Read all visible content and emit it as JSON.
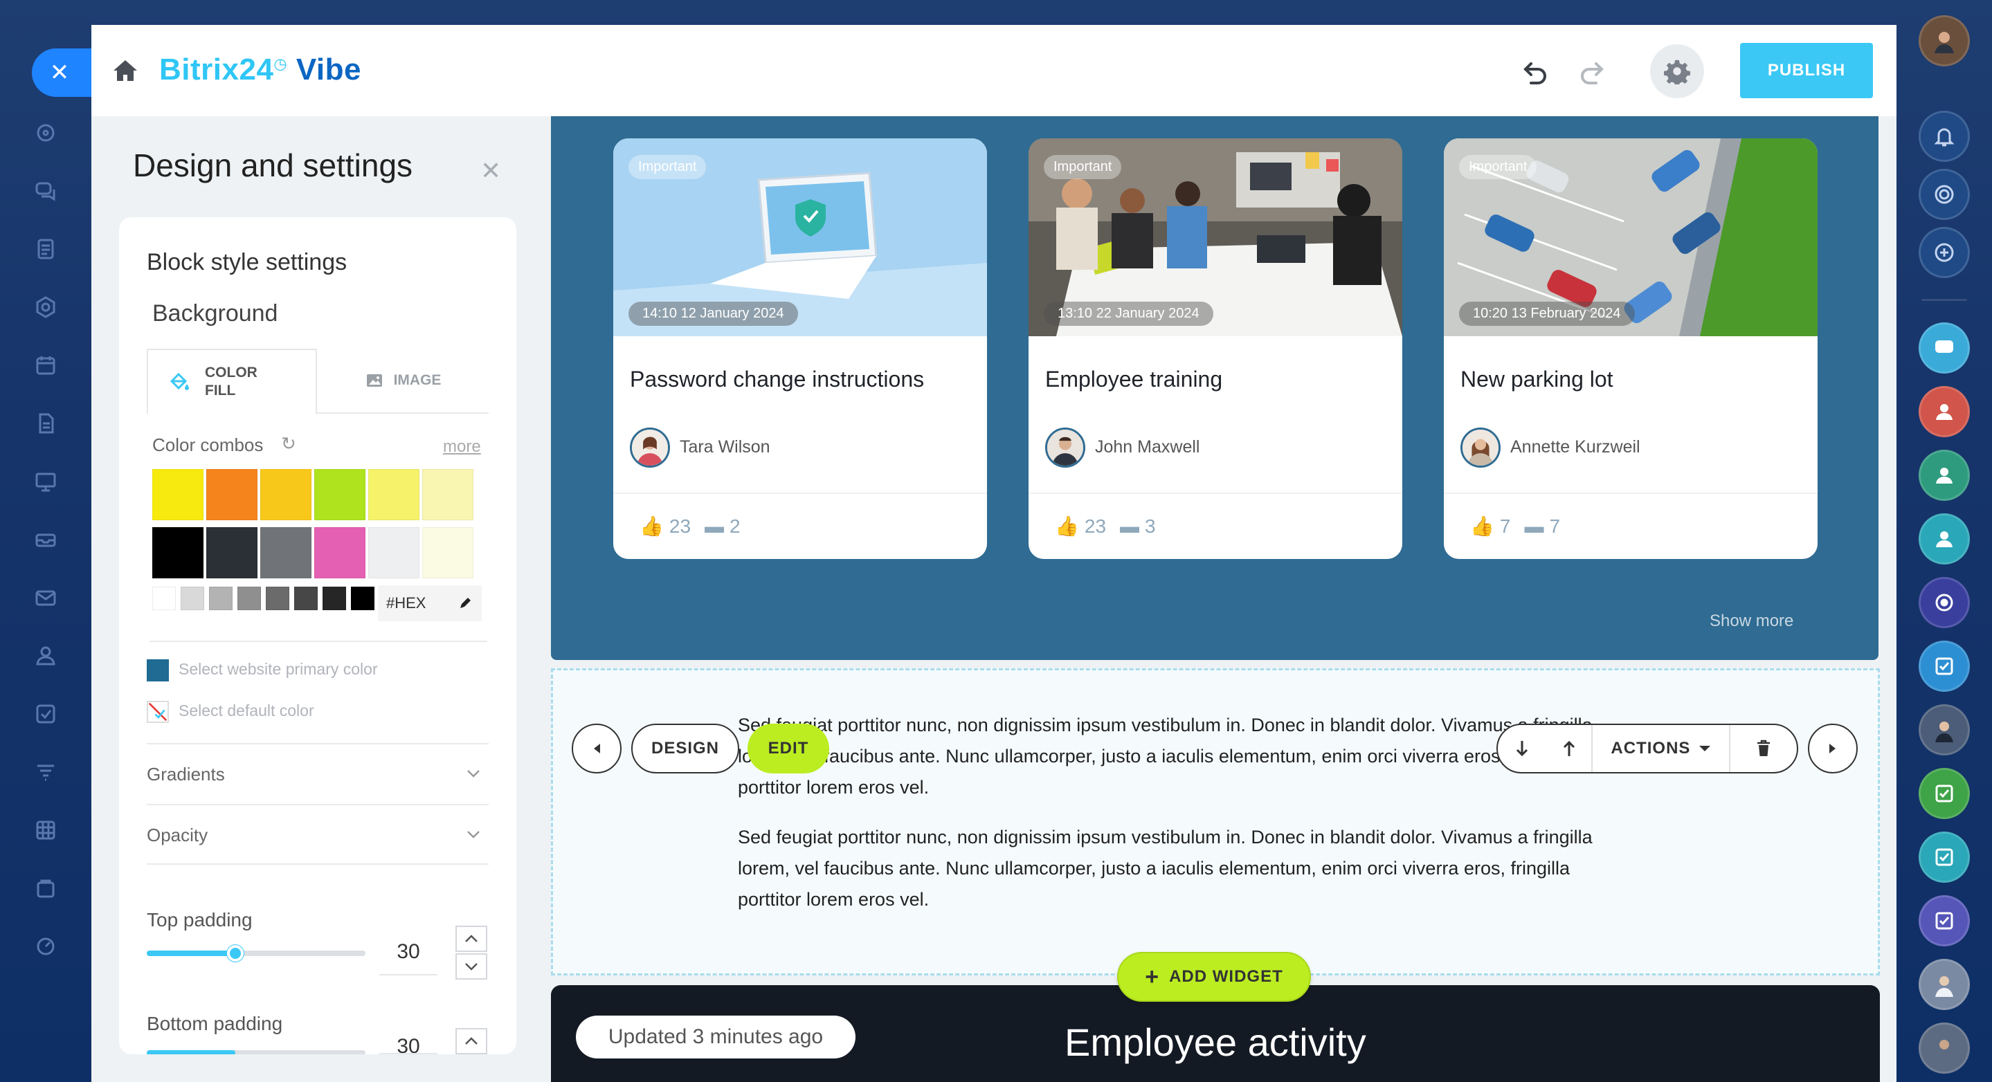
{
  "app": {
    "brand_main": "Bitrix24",
    "brand_sub": "Vibe",
    "publish_label": "PUBLISH"
  },
  "panel": {
    "title": "Design and settings",
    "block_style": "Block style settings",
    "background": "Background",
    "tab_color_line1": "COLOR",
    "tab_color_line2": "FILL",
    "tab_image": "IMAGE",
    "color_combos": "Color combos",
    "more": "more",
    "hex_placeholder": "#HEX",
    "swatches_row1": [
      "#f7ea0f",
      "#f5841d",
      "#f7c81a",
      "#aee31e",
      "#f6f26a",
      "#f8f6b0"
    ],
    "swatches_row2": [
      "#000000",
      "#2b2f36",
      "#707378",
      "#e460b2",
      "#eeeff1",
      "#fbfbe4"
    ],
    "mini_swatches": [
      "#ffffff",
      "#d9d9d9",
      "#b3b3b3",
      "#8f8f8f",
      "#6b6b6b",
      "#474747",
      "#262626",
      "#000000"
    ],
    "primary_color_label": "Select website primary color",
    "primary_color": "#1f6b93",
    "default_color_label": "Select default color",
    "gradients": "Gradients",
    "opacity": "Opacity",
    "top_padding_label": "Top padding",
    "top_padding_value": "30",
    "bottom_padding_label": "Bottom padding",
    "bottom_padding_value": "30"
  },
  "news": {
    "cards": [
      {
        "badge": "Important",
        "date": "14:10 12 January 2024",
        "title": "Password change instructions",
        "author": "Tara Wilson",
        "likes": "23",
        "comments": "2"
      },
      {
        "badge": "Important",
        "date": "13:10 22 January 2024",
        "title": "Employee training",
        "author": "John Maxwell",
        "likes": "23",
        "comments": "3"
      },
      {
        "badge": "Important",
        "date": "10:20 13 February 2024",
        "title": "New parking lot",
        "author": "Annette Kurzweil",
        "likes": "7",
        "comments": "7"
      }
    ],
    "show_more": "Show more"
  },
  "text_block": {
    "para1_line1": "Sed feugiat porttitor nunc, non dignissim ipsum vestibulum in. Donec in blandit dolor. Vivamus a fringilla",
    "para1_line2": "lorem, vel faucibus ante. Nunc ullamcorper, justo a iaculis elementum, enim orci viverra eros, fringilla",
    "para1_line3": "porttitor lorem eros vel.",
    "para2_line1": "Sed feugiat porttitor nunc, non dignissim ipsum vestibulum in. Donec in blandit dolor. Vivamus a fringilla",
    "para2_line2": "lorem, vel faucibus ante. Nunc ullamcorper, justo a iaculis elementum, enim orci viverra eros, fringilla",
    "para2_line3": "porttitor lorem eros vel.",
    "design_label": "DESIGN",
    "edit_label": "EDIT",
    "actions_label": "ACTIONS"
  },
  "add_widget_label": "ADD WIDGET",
  "activity": {
    "updated": "Updated 3 minutes ago",
    "title": "Employee activity"
  },
  "colors": {
    "accent": "#3bc8f5",
    "brand_blue": "#0b66c3",
    "lime": "#bbed21",
    "news_bg": "#2f6b92"
  }
}
